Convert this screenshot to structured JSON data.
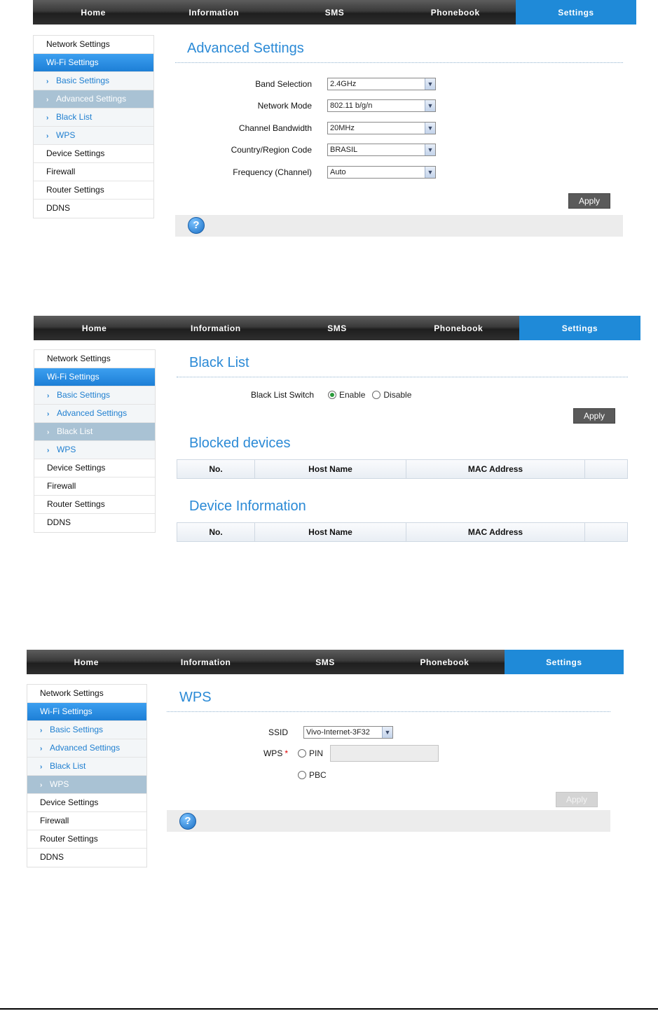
{
  "nav": [
    "Home",
    "Information",
    "SMS",
    "Phonebook",
    "Settings"
  ],
  "sidebar": {
    "network": "Network Settings",
    "wifi": "Wi-Fi Settings",
    "sub": [
      "Basic Settings",
      "Advanced Settings",
      "Black List",
      "WPS"
    ],
    "device": "Device Settings",
    "firewall": "Firewall",
    "router": "Router Settings",
    "ddns": "DDNS",
    "arrow": "›"
  },
  "advanced": {
    "title": "Advanced Settings",
    "rows": [
      {
        "label": "Band Selection",
        "value": "2.4GHz"
      },
      {
        "label": "Network Mode",
        "value": "802.11 b/g/n"
      },
      {
        "label": "Channel Bandwidth",
        "value": "20MHz"
      },
      {
        "label": "Country/Region Code",
        "value": "BRASIL"
      },
      {
        "label": "Frequency (Channel)",
        "value": "Auto"
      }
    ],
    "apply": "Apply",
    "help": "?"
  },
  "blacklist": {
    "title": "Black List",
    "switch_label": "Black List Switch",
    "enable": "Enable",
    "disable": "Disable",
    "apply": "Apply",
    "blocked_title": "Blocked devices",
    "device_info_title": "Device Information",
    "columns": [
      "No.",
      "Host Name",
      "MAC Address",
      ""
    ]
  },
  "wps": {
    "title": "WPS",
    "ssid_label": "SSID",
    "ssid_value": "Vivo-Internet-3F32",
    "wps_label": "WPS",
    "required_mark": "*",
    "pin": "PIN",
    "pbc": "PBC",
    "apply": "Apply",
    "help": "?"
  },
  "colors": {
    "accent": "#1f8ad8",
    "title": "#2b8ad6",
    "nav_bg": "#2e2e2e"
  },
  "icons": {
    "dropdown": "chevron-down-icon",
    "help": "help-icon",
    "arrow": "chevron-right-icon"
  }
}
